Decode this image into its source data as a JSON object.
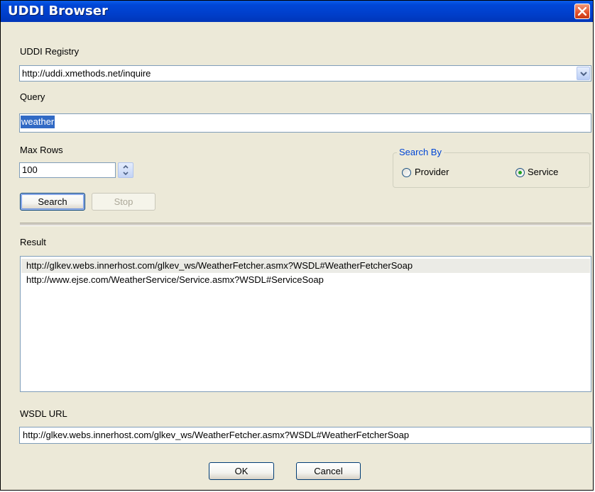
{
  "window": {
    "title": "UDDI Browser"
  },
  "registry": {
    "label": "UDDI Registry",
    "selected": "http://uddi.xmethods.net/inquire"
  },
  "query": {
    "label": "Query",
    "value": "weather"
  },
  "max_rows": {
    "label": "Max Rows",
    "value": "100"
  },
  "search_by": {
    "title": "Search By",
    "options": [
      {
        "label": "Provider",
        "selected": false
      },
      {
        "label": "Service",
        "selected": true
      }
    ]
  },
  "buttons": {
    "search": "Search",
    "stop": "Stop",
    "ok": "OK",
    "cancel": "Cancel"
  },
  "result": {
    "label": "Result",
    "items": [
      "http://glkev.webs.innerhost.com/glkev_ws/WeatherFetcher.asmx?WSDL#WeatherFetcherSoap",
      "http://www.ejse.com/WeatherService/Service.asmx?WSDL#ServiceSoap"
    ],
    "selected_index": 0
  },
  "wsdl": {
    "label": "WSDL URL",
    "value": "http://glkev.webs.innerhost.com/glkev_ws/WeatherFetcher.asmx?WSDL#WeatherFetcherSoap"
  },
  "colors": {
    "titlebar": "#0047d6",
    "dialog_bg": "#ece9d8",
    "selection": "#316ac5",
    "groupbox_title": "#0046d5"
  }
}
